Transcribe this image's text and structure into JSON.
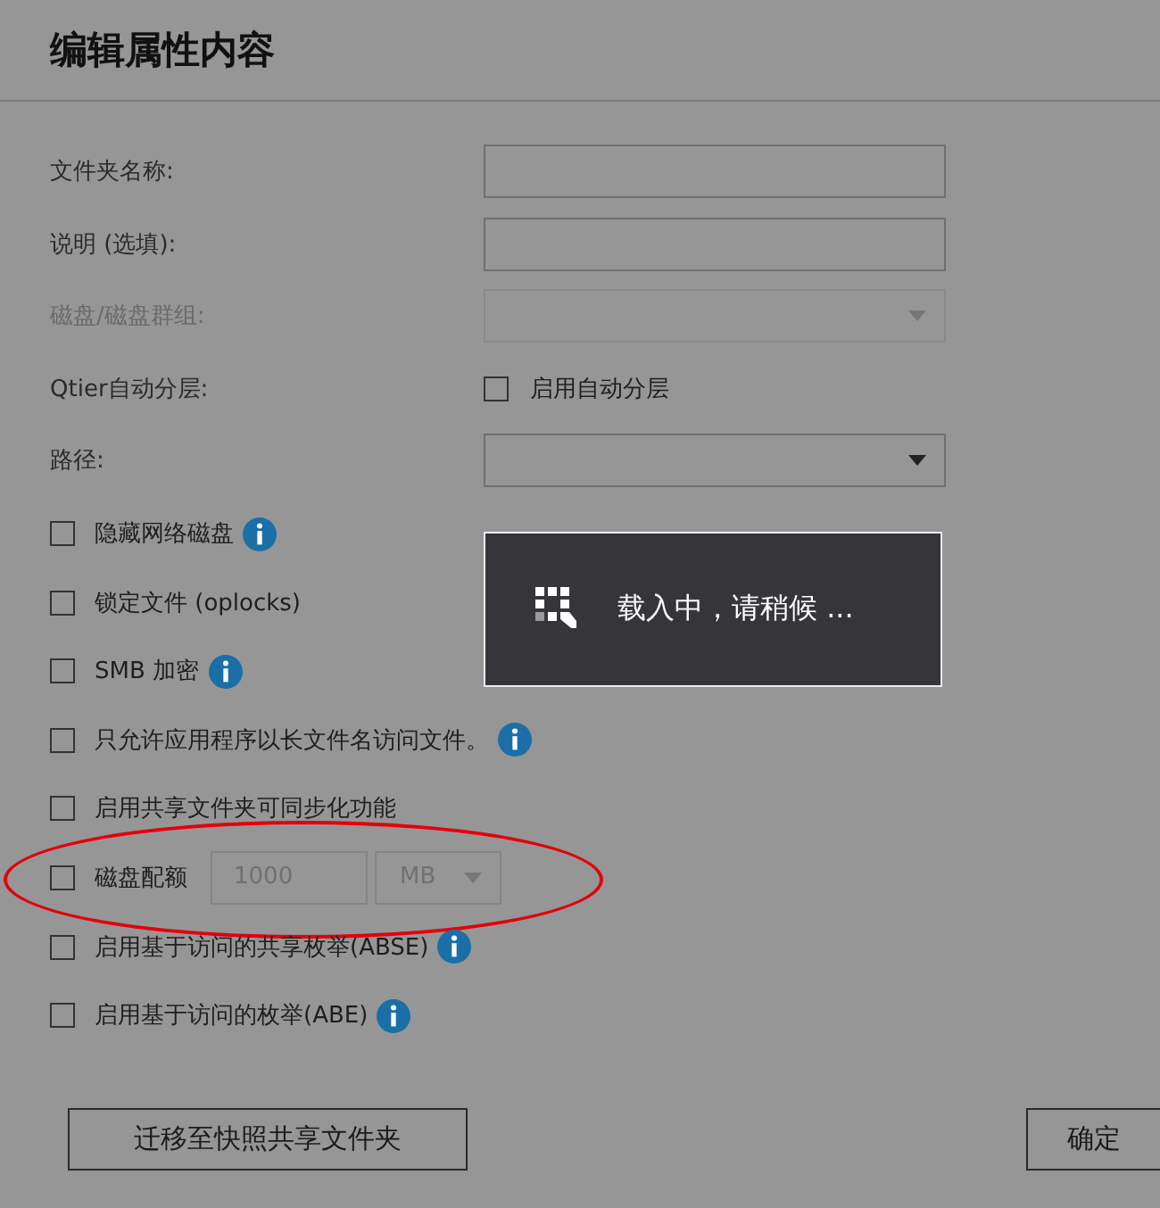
{
  "dialog": {
    "title": "编辑属性内容"
  },
  "fields": [
    {
      "kind": "text",
      "label": "文件夹名称:",
      "disabled": false
    },
    {
      "kind": "text",
      "label": "说明 (选填):",
      "disabled": false
    },
    {
      "kind": "select",
      "label": "磁盘/磁盘群组:",
      "disabled": true
    },
    {
      "kind": "checkbox",
      "label": "Qtier自动分层:",
      "option": "启用自动分层",
      "checked": false
    },
    {
      "kind": "select",
      "label": "路径:",
      "disabled": false
    }
  ],
  "options": [
    {
      "kind": "check",
      "label": "隐藏网络磁盘",
      "checked": false,
      "info": true
    },
    {
      "kind": "check",
      "label": "锁定文件 (oplocks)",
      "checked": false,
      "info": false
    },
    {
      "kind": "check",
      "label": "SMB 加密",
      "checked": false,
      "info": true
    },
    {
      "kind": "check",
      "label": "只允许应用程序以长文件名访问文件。",
      "checked": false,
      "info": true
    },
    {
      "kind": "check",
      "label": "启用共享文件夹可同步化功能",
      "checked": false,
      "info": false
    },
    {
      "kind": "quota",
      "label": "磁盘配额",
      "checked": false,
      "info": false,
      "circled": true,
      "value": "1000",
      "unit": "MB"
    },
    {
      "kind": "check",
      "label": "启用基于访问的共享枚举(ABSE)",
      "checked": false,
      "info": true
    },
    {
      "kind": "check",
      "label": "启用基于访问的枚举(ABE)",
      "checked": false,
      "info": true
    }
  ],
  "loading": {
    "message": "载入中，请稍候 ..."
  },
  "buttons": [
    {
      "label": "迁移至快照共享文件夹",
      "kind": "left"
    },
    {
      "label": "确定",
      "kind": "right"
    }
  ]
}
